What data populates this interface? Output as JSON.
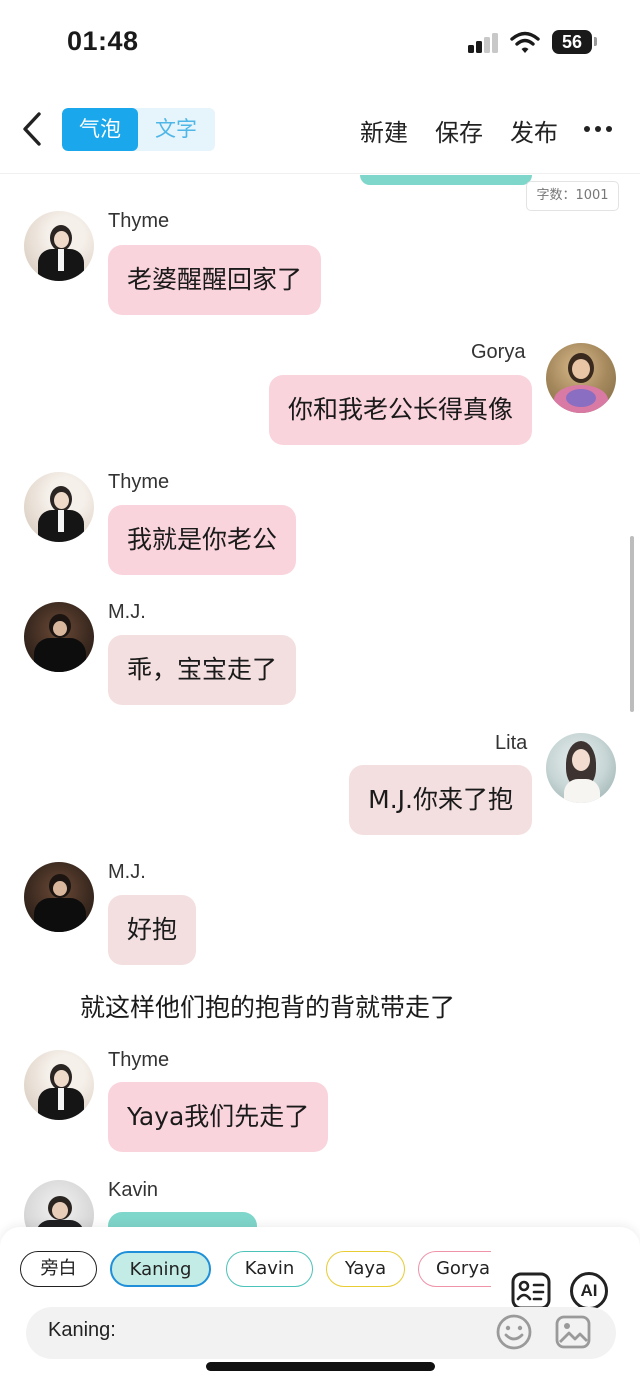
{
  "status_bar": {
    "time": "01:48",
    "battery": "56"
  },
  "nav": {
    "tabs": [
      {
        "label": "气泡",
        "active": true
      },
      {
        "label": "文字",
        "active": false
      }
    ],
    "actions": {
      "new": "新建",
      "save": "保存",
      "publish": "发布"
    }
  },
  "chat": {
    "word_count": "字数：1001",
    "messages": [
      {
        "speaker": "Thyme",
        "text": "老婆醒醒回家了",
        "side": "left"
      },
      {
        "speaker": "Gorya",
        "text": "你和我老公长得真像",
        "side": "right"
      },
      {
        "speaker": "Thyme",
        "text": "我就是你老公",
        "side": "left"
      },
      {
        "speaker": "M.J.",
        "text": "乖，宝宝走了",
        "side": "left"
      },
      {
        "speaker": "Lita",
        "text": "M.J.你来了抱",
        "side": "right"
      },
      {
        "speaker": "M.J.",
        "text": "好抱",
        "side": "left"
      },
      {
        "narration": "就这样他们抱的抱背的背就带走了"
      },
      {
        "speaker": "Thyme",
        "text": "Yaya我们先走了",
        "side": "left"
      },
      {
        "speaker": "Kavin",
        "text": "",
        "side": "left"
      }
    ]
  },
  "composer": {
    "roles": [
      {
        "label": "旁白",
        "selected": false,
        "color": "#222222"
      },
      {
        "label": "Kaning",
        "selected": true,
        "color": "#1e8fd8"
      },
      {
        "label": "Kavin",
        "selected": false,
        "color": "#4cc3b8"
      },
      {
        "label": "Yaya",
        "selected": false,
        "color": "#e8cc33"
      },
      {
        "label": "Gorya",
        "selected": false,
        "color": "#ef93a9"
      }
    ],
    "ai_label": "AI",
    "input_prefix": "Kaning:",
    "input_value": ""
  },
  "colors": {
    "accent": "#1aa7ec",
    "bubble_pink": "#fad4dd",
    "bubble_rose": "#f4dfe0",
    "bubble_teal": "#7fd6cb"
  }
}
